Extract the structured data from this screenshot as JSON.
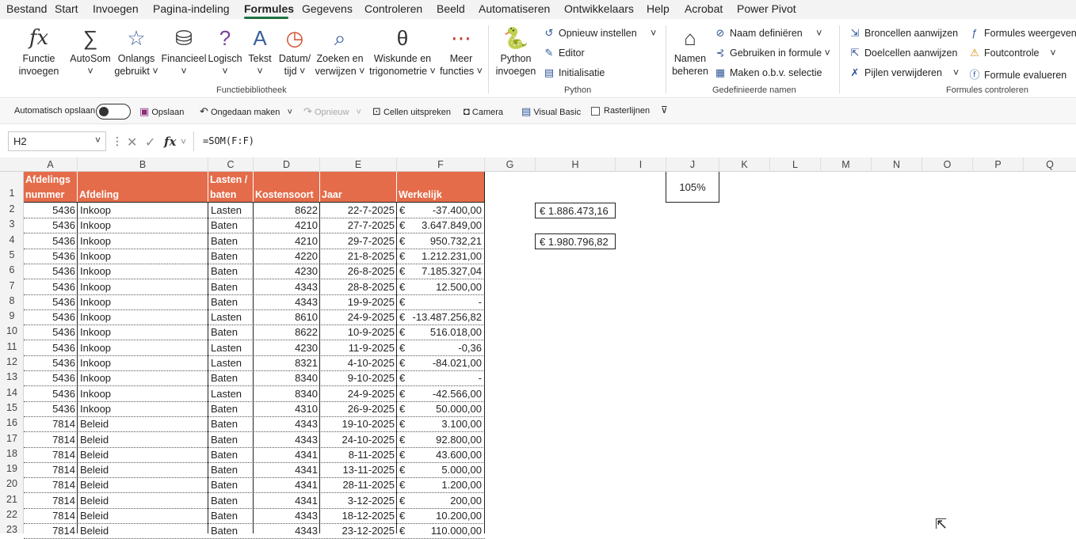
{
  "menu": {
    "tabs": [
      "Bestand",
      "Start",
      "Invoegen",
      "Pagina-indeling",
      "Formules",
      "Gegevens",
      "Controleren",
      "Beeld",
      "Automatiseren",
      "Ontwikkelaars",
      "Help",
      "Acrobat",
      "Power Pivot"
    ],
    "active": "Formules"
  },
  "ribbon": {
    "functie": {
      "line1": "Functie",
      "line2": "invoegen",
      "icon": "fx-icon"
    },
    "autosom": {
      "line1": "AutoSom",
      "line2": "˅"
    },
    "onlangs": {
      "line1": "Onlangs",
      "line2": "gebruikt ˅"
    },
    "financieel": {
      "line1": "Financieel",
      "line2": "˅"
    },
    "logisch": {
      "line1": "Logisch",
      "line2": "˅"
    },
    "tekst": {
      "line1": "Tekst",
      "line2": "˅"
    },
    "datum": {
      "line1": "Datum/",
      "line2": "tijd ˅"
    },
    "zoeken": {
      "line1": "Zoeken en",
      "line2": "verwijzen ˅"
    },
    "wiskunde": {
      "line1": "Wiskunde en",
      "line2": "trigonometrie ˅"
    },
    "meer": {
      "line1": "Meer",
      "line2": "functies ˅"
    },
    "functiebibliotheek": "Functiebibliotheek",
    "python_invoegen": {
      "line1": "Python",
      "line2": "invoegen"
    },
    "opnieuw_instellen": "Opnieuw instellen",
    "editor": "Editor",
    "initialisatie": "Initialisatie",
    "python_group": "Python",
    "namen": {
      "line1": "Namen",
      "line2": "beheren"
    },
    "naam_definieren": "Naam definiëren",
    "gebruiken_in_formule": "Gebruiken in formule",
    "maken_selectie": "Maken o.b.v. selectie",
    "gedefinieerde_namen": "Gedefinieerde namen",
    "broncellen": "Broncellen aanwijzen",
    "doelcellen": "Doelcellen aanwijzen",
    "pijlen": "Pijlen verwijderen",
    "formules_weergeven": "Formules weergeven",
    "foutcontrole": "Foutcontrole",
    "formule_evalueren": "Formule evalueren",
    "formules_controleren": "Formules controleren"
  },
  "qat": {
    "autosave": "Automatisch opslaan",
    "opslaan": "Opslaan",
    "ongedaan": "Ongedaan maken",
    "opnieuw": "Opnieuw",
    "cellen": "Cellen uitspreken",
    "camera": "Camera",
    "visual_basic": "Visual Basic",
    "rasterlijnen": "Rasterlijnen"
  },
  "formula_bar": {
    "name_box": "H2",
    "formula": "=SOM(F:F)"
  },
  "columns": [
    "A",
    "B",
    "C",
    "D",
    "E",
    "F",
    "G",
    "H",
    "I",
    "J",
    "K",
    "L",
    "M",
    "N",
    "O",
    "P",
    "Q"
  ],
  "header_row": {
    "a1": "Afdelings",
    "a2": "nummer",
    "b": "Afdeling",
    "c1": "Lasten /",
    "c2": "baten",
    "d": "Kostensoort",
    "e": "Jaar",
    "f": "Werkelijk"
  },
  "rows": [
    {
      "n": "2",
      "a": "5436",
      "b": "Inkoop",
      "c": "Lasten",
      "d": "8622",
      "e": "22-7-2025",
      "f": "-37.400,00"
    },
    {
      "n": "3",
      "a": "5436",
      "b": "Inkoop",
      "c": "Baten",
      "d": "4210",
      "e": "27-7-2025",
      "f": "3.647.849,00"
    },
    {
      "n": "4",
      "a": "5436",
      "b": "Inkoop",
      "c": "Baten",
      "d": "4210",
      "e": "29-7-2025",
      "f": "950.732,21"
    },
    {
      "n": "5",
      "a": "5436",
      "b": "Inkoop",
      "c": "Baten",
      "d": "4220",
      "e": "21-8-2025",
      "f": "1.212.231,00"
    },
    {
      "n": "6",
      "a": "5436",
      "b": "Inkoop",
      "c": "Baten",
      "d": "4230",
      "e": "26-8-2025",
      "f": "7.185.327,04"
    },
    {
      "n": "7",
      "a": "5436",
      "b": "Inkoop",
      "c": "Baten",
      "d": "4343",
      "e": "28-8-2025",
      "f": "12.500,00"
    },
    {
      "n": "8",
      "a": "5436",
      "b": "Inkoop",
      "c": "Baten",
      "d": "4343",
      "e": "19-9-2025",
      "f": "-"
    },
    {
      "n": "9",
      "a": "5436",
      "b": "Inkoop",
      "c": "Lasten",
      "d": "8610",
      "e": "24-9-2025",
      "f": "-13.487.256,82"
    },
    {
      "n": "10",
      "a": "5436",
      "b": "Inkoop",
      "c": "Baten",
      "d": "8622",
      "e": "10-9-2025",
      "f": "516.018,00"
    },
    {
      "n": "11",
      "a": "5436",
      "b": "Inkoop",
      "c": "Lasten",
      "d": "4230",
      "e": "11-9-2025",
      "f": "-0,36"
    },
    {
      "n": "12",
      "a": "5436",
      "b": "Inkoop",
      "c": "Lasten",
      "d": "8321",
      "e": "4-10-2025",
      "f": "-84.021,00"
    },
    {
      "n": "13",
      "a": "5436",
      "b": "Inkoop",
      "c": "Baten",
      "d": "8340",
      "e": "9-10-2025",
      "f": "-"
    },
    {
      "n": "14",
      "a": "5436",
      "b": "Inkoop",
      "c": "Lasten",
      "d": "8340",
      "e": "24-9-2025",
      "f": "-42.566,00"
    },
    {
      "n": "15",
      "a": "5436",
      "b": "Inkoop",
      "c": "Baten",
      "d": "4310",
      "e": "26-9-2025",
      "f": "50.000,00"
    },
    {
      "n": "16",
      "a": "7814",
      "b": "Beleid",
      "c": "Baten",
      "d": "4343",
      "e": "19-10-2025",
      "f": "3.100,00"
    },
    {
      "n": "17",
      "a": "7814",
      "b": "Beleid",
      "c": "Baten",
      "d": "4343",
      "e": "24-10-2025",
      "f": "92.800,00"
    },
    {
      "n": "18",
      "a": "7814",
      "b": "Beleid",
      "c": "Baten",
      "d": "4341",
      "e": "8-11-2025",
      "f": "43.600,00"
    },
    {
      "n": "19",
      "a": "7814",
      "b": "Beleid",
      "c": "Baten",
      "d": "4341",
      "e": "13-11-2025",
      "f": "5.000,00"
    },
    {
      "n": "20",
      "a": "7814",
      "b": "Beleid",
      "c": "Baten",
      "d": "4341",
      "e": "28-11-2025",
      "f": "1.200,00"
    },
    {
      "n": "21",
      "a": "7814",
      "b": "Beleid",
      "c": "Baten",
      "d": "4341",
      "e": "3-12-2025",
      "f": "200,00"
    },
    {
      "n": "22",
      "a": "7814",
      "b": "Beleid",
      "c": "Baten",
      "d": "4343",
      "e": "18-12-2025",
      "f": "10.200,00"
    },
    {
      "n": "23",
      "a": "7814",
      "b": "Beleid",
      "c": "Baten",
      "d": "4343",
      "e": "23-12-2025",
      "f": "110.000,00"
    }
  ],
  "currency_symbol": "€",
  "row1_label": "1",
  "j1": "105%",
  "h2": "€ 1.886.473,16",
  "h4": "€ 1.980.796,82",
  "accent_color": "#e46c4a",
  "excel_green": "#1f7244"
}
